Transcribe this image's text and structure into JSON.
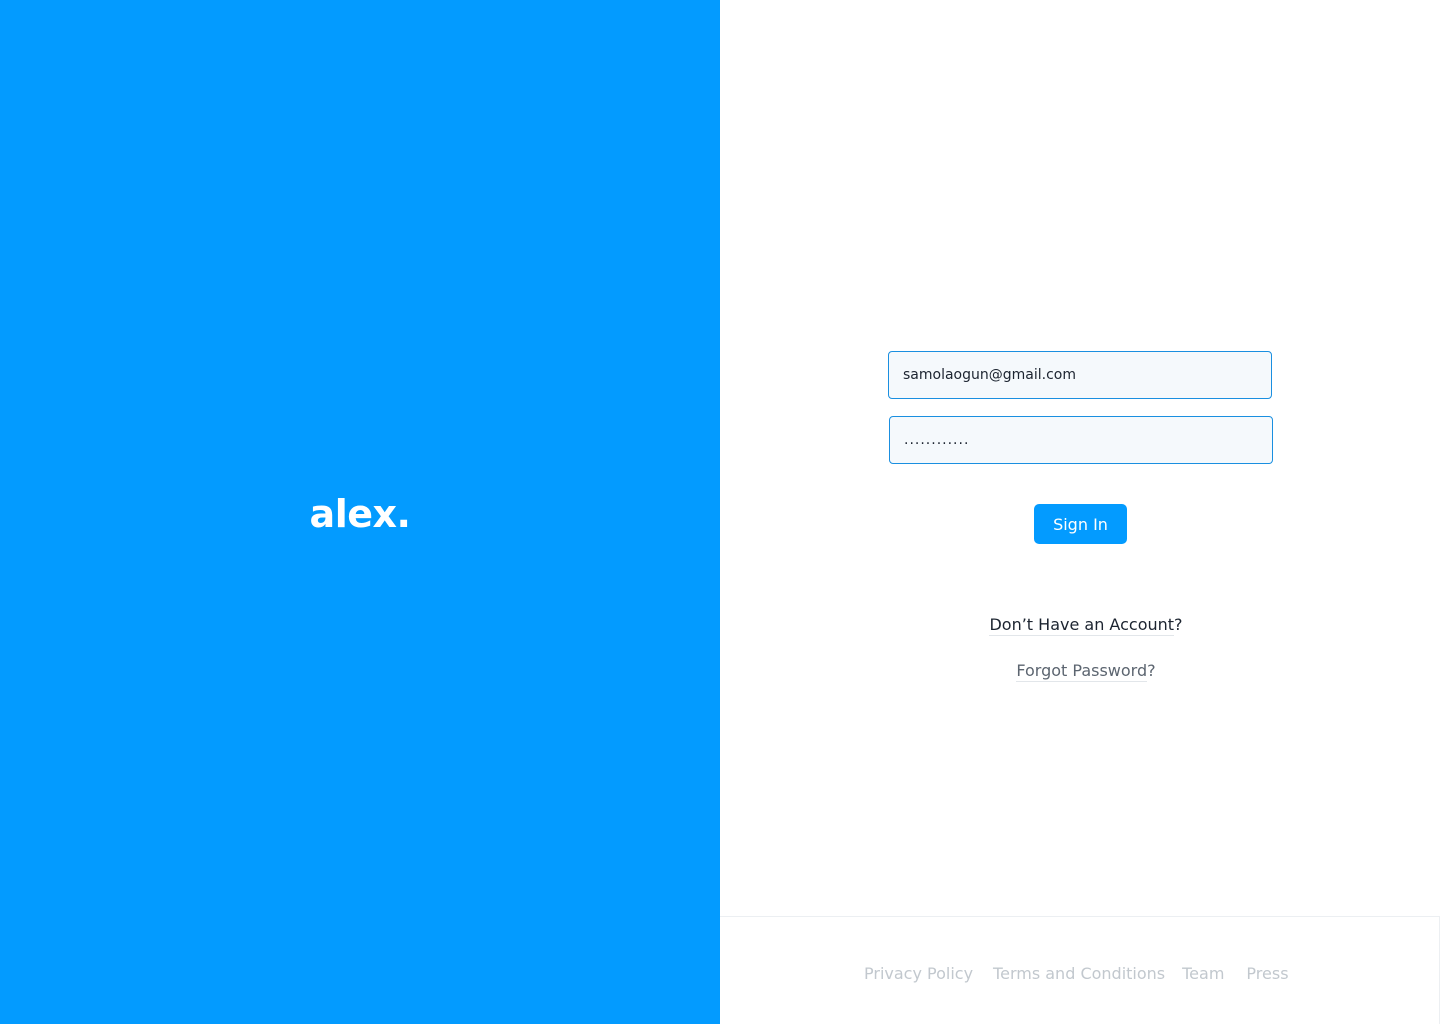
{
  "brand": {
    "logo_text": "alex."
  },
  "form": {
    "email_value": "samolaogun@gmail.com",
    "password_value": "............",
    "signin_label": "Sign In"
  },
  "links": {
    "signup_text": "Don’t Have an Account",
    "signup_suffix": "?",
    "forgot_text": "Forgot Password",
    "forgot_suffix": "?"
  },
  "footer": {
    "items": [
      {
        "label": "Privacy Policy"
      },
      {
        "label": "Terms and Conditions"
      },
      {
        "label": "Team"
      },
      {
        "label": "Press"
      }
    ]
  },
  "colors": {
    "brand_blue": "#039bff",
    "field_border": "#1a8fe0",
    "footer_text": "#c2c8ce"
  }
}
